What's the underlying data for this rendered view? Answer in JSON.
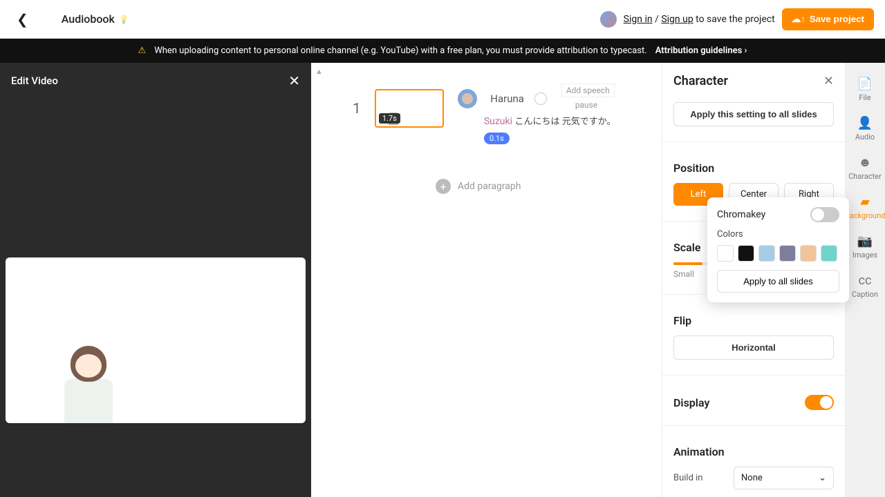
{
  "topbar": {
    "title": "Audiobook",
    "signin": "Sign in",
    "sep": " / ",
    "signup": "Sign up",
    "save_hint": " to save the project",
    "save_btn": "Save project"
  },
  "banner": {
    "text": "When uploading content to personal online channel (e.g. YouTube) with a free plan, you must provide attribution to typecast.",
    "link": "Attribution guidelines"
  },
  "left": {
    "title": "Edit Video"
  },
  "center": {
    "slide_num": "1",
    "thumb_duration": "1.7s",
    "speaker": "Haruna",
    "add_speech": "Add speech",
    "pause": "pause",
    "subname": "Suzuki",
    "jp_text": "こんにちは 元気ですか。",
    "chip": "0.1s",
    "add_paragraph": "Add paragraph"
  },
  "right": {
    "title": "Character",
    "apply_all": "Apply this setting to all slides",
    "position_label": "Position",
    "positions": [
      "Left",
      "Center",
      "Right"
    ],
    "scale_label": "Scale",
    "scale_small": "Small",
    "flip_label": "Flip",
    "flip_btn": "Horizontal",
    "display_label": "Display",
    "animation_label": "Animation",
    "buildin_label": "Build in",
    "buildin_value": "None"
  },
  "popover": {
    "chromakey": "Chromakey",
    "colors_label": "Colors",
    "swatches": [
      "#ffffff",
      "#111111",
      "#a8cce6",
      "#7d7d9c",
      "#f0c49a",
      "#6ed4cd"
    ],
    "apply": "Apply to all slides"
  },
  "sidebar": {
    "items": [
      {
        "label": "File"
      },
      {
        "label": "Audio"
      },
      {
        "label": "Character"
      },
      {
        "label": "Background"
      },
      {
        "label": "Images"
      },
      {
        "label": "Caption"
      }
    ]
  }
}
